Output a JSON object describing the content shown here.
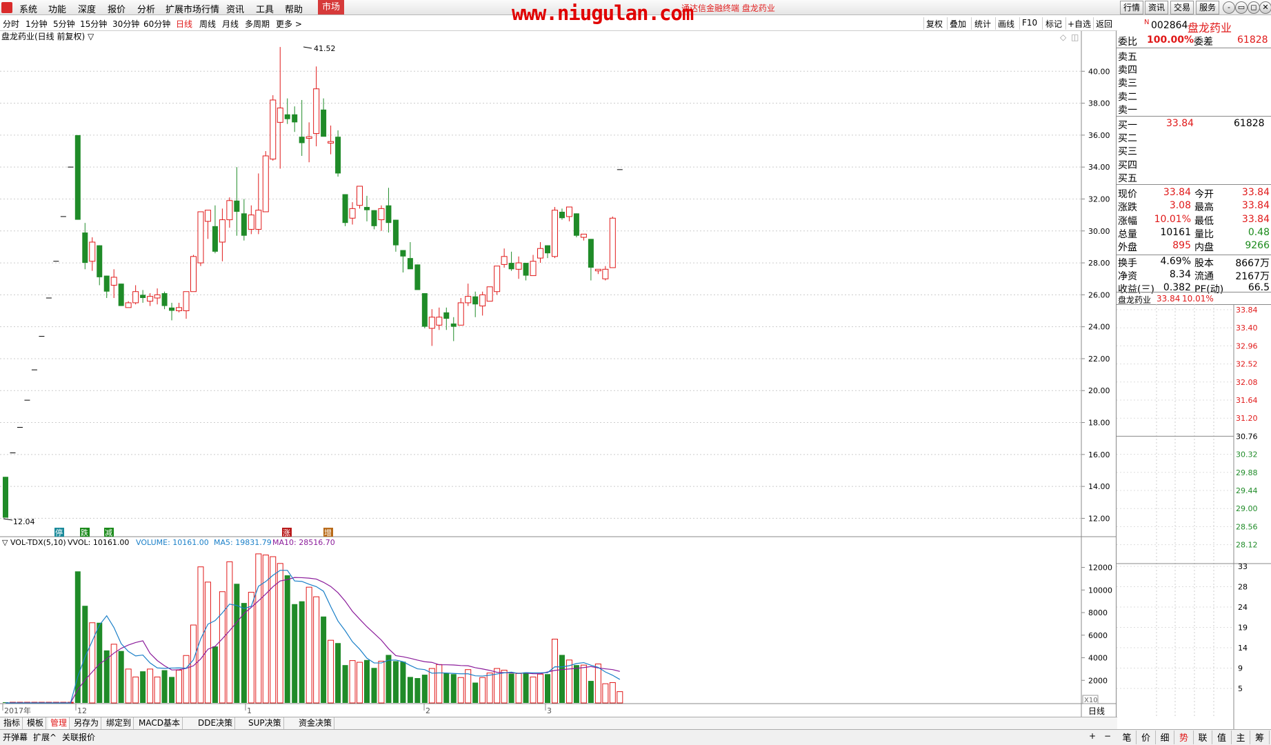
{
  "menu": [
    "系统",
    "功能",
    "深度",
    "报价",
    "分析",
    "扩展市场行情",
    "资讯",
    "工具",
    "帮助"
  ],
  "market_tab": "市场",
  "subtitle": "通达信金融终端 盘龙药业",
  "watermark": "www.niugulan.com",
  "top_buttons": [
    "行情",
    "资讯",
    "交易",
    "服务"
  ],
  "window_controls": [
    "-",
    "▭",
    "◻",
    "✕"
  ],
  "periods": [
    "分时",
    "1分钟",
    "5分钟",
    "15分钟",
    "30分钟",
    "60分钟",
    "日线",
    "周线",
    "月线",
    "多周期",
    "更多 >"
  ],
  "active_period": "日线",
  "toolbar_right": [
    "复权",
    "叠加",
    "统计",
    "画线",
    "F10",
    "标记",
    "+自选",
    "返回"
  ],
  "chart_title": "盘龙药业(日线 前复权) ▽",
  "price_axis": [
    "40.00",
    "38.00",
    "36.00",
    "34.00",
    "32.00",
    "30.00",
    "28.00",
    "26.00",
    "24.00",
    "22.00",
    "20.00",
    "18.00",
    "16.00",
    "14.00",
    "12.00"
  ],
  "high_label": "41.52",
  "low_label": "12.04",
  "signals": [
    {
      "t": "停",
      "color": "#1a8a9a"
    },
    {
      "t": "跌",
      "color": "#1a8a1a"
    },
    {
      "t": "减",
      "color": "#1a8a1a"
    },
    {
      "t": "涨",
      "color": "#b81818"
    },
    {
      "t": "增",
      "color": "#b86a18"
    }
  ],
  "vol_header": {
    "name": "▽ VOL-TDX(5,10)",
    "vvol": "VVOL: 10161.00",
    "volume": "VOLUME: 10161.00",
    "ma5": "MA5: 19831.79",
    "ma10": "MA10: 28516.70"
  },
  "vol_axis": [
    "12000",
    "10000",
    "8000",
    "6000",
    "4000",
    "2000"
  ],
  "vol_unit": "X10",
  "date_labels": [
    "2017年",
    "12",
    "1",
    "2",
    "3"
  ],
  "period_right": "日线",
  "chart_data": {
    "type": "candlestick",
    "title": "盘龙药业(日线 前复权)",
    "ylim": [
      11.5,
      42.0
    ],
    "candles": [
      [
        14.6,
        12.04,
        14.6,
        12.04
      ],
      [
        16.1,
        16.1,
        16.1,
        16.1
      ],
      [
        17.7,
        17.7,
        17.7,
        17.7
      ],
      [
        19.4,
        19.4,
        19.4,
        19.4
      ],
      [
        21.3,
        21.3,
        21.3,
        21.3
      ],
      [
        23.4,
        23.4,
        23.4,
        23.4
      ],
      [
        25.8,
        25.8,
        25.8,
        25.8
      ],
      [
        28.1,
        28.1,
        28.1,
        28.1
      ],
      [
        30.9,
        30.9,
        30.9,
        30.9
      ],
      [
        34.0,
        34.0,
        34.0,
        34.0
      ],
      [
        36.0,
        36.0,
        30.7,
        30.7
      ],
      [
        29.9,
        30.5,
        27.6,
        28.0
      ],
      [
        28.1,
        29.6,
        27.5,
        29.3
      ],
      [
        29.1,
        29.1,
        26.6,
        27.1
      ],
      [
        27.2,
        27.2,
        25.8,
        26.2
      ],
      [
        26.6,
        27.6,
        25.8,
        27.1
      ],
      [
        26.7,
        26.7,
        25.3,
        25.3
      ],
      [
        25.2,
        25.6,
        25.2,
        25.5
      ],
      [
        25.5,
        26.6,
        25.4,
        26.2
      ],
      [
        26.0,
        26.3,
        25.5,
        25.8
      ],
      [
        25.6,
        26.1,
        25.3,
        25.9
      ],
      [
        25.8,
        26.4,
        25.4,
        26.0
      ],
      [
        26.1,
        26.2,
        25.1,
        25.3
      ],
      [
        25.2,
        25.5,
        24.4,
        25.0
      ],
      [
        25.0,
        25.5,
        24.9,
        25.2
      ],
      [
        25.0,
        26.1,
        24.5,
        26.2
      ],
      [
        26.2,
        28.5,
        26.2,
        28.4
      ],
      [
        28.0,
        31.2,
        27.8,
        31.2
      ],
      [
        30.6,
        31.3,
        29.5,
        31.3
      ],
      [
        30.3,
        31.6,
        28.6,
        28.7
      ],
      [
        29.3,
        31.4,
        28.1,
        30.7
      ],
      [
        30.7,
        32.1,
        30.2,
        31.9
      ],
      [
        31.9,
        34.0,
        29.7,
        31.2
      ],
      [
        31.1,
        32.0,
        29.4,
        29.7
      ],
      [
        30.1,
        31.6,
        29.8,
        31.0
      ],
      [
        30.1,
        33.6,
        29.8,
        31.3
      ],
      [
        31.2,
        35.0,
        31.2,
        34.7
      ],
      [
        34.5,
        38.5,
        34.4,
        38.2
      ],
      [
        36.8,
        41.52,
        33.9,
        37.7
      ],
      [
        37.3,
        38.3,
        36.7,
        37.0
      ],
      [
        37.3,
        37.8,
        36.2,
        36.8
      ],
      [
        35.9,
        38.2,
        34.7,
        35.5
      ],
      [
        35.8,
        36.8,
        34.3,
        35.9
      ],
      [
        36.1,
        40.3,
        35.3,
        38.9
      ],
      [
        37.6,
        38.3,
        36.1,
        35.9
      ],
      [
        35.5,
        36.6,
        34.8,
        35.6
      ],
      [
        35.9,
        36.3,
        33.4,
        33.6
      ],
      [
        32.3,
        32.3,
        30.3,
        30.5
      ],
      [
        30.8,
        31.8,
        30.4,
        31.4
      ],
      [
        31.6,
        32.3,
        31.4,
        32.8
      ],
      [
        31.5,
        32.2,
        30.6,
        31.3
      ],
      [
        31.3,
        31.3,
        30.1,
        30.3
      ],
      [
        30.7,
        31.6,
        30.0,
        31.4
      ],
      [
        31.6,
        32.7,
        29.9,
        30.5
      ],
      [
        30.7,
        30.7,
        28.7,
        29.1
      ],
      [
        28.8,
        28.8,
        27.4,
        28.4
      ],
      [
        28.3,
        29.3,
        27.8,
        27.6
      ],
      [
        27.9,
        27.9,
        26.5,
        26.3
      ],
      [
        26.1,
        26.1,
        23.9,
        24.0
      ],
      [
        23.9,
        25.1,
        22.8,
        24.6
      ],
      [
        24.1,
        25.2,
        23.8,
        24.6
      ],
      [
        24.9,
        25.2,
        23.8,
        24.5
      ],
      [
        24.2,
        24.6,
        23.1,
        24.0
      ],
      [
        24.1,
        25.8,
        24.1,
        25.5
      ],
      [
        25.5,
        26.7,
        25.3,
        25.9
      ],
      [
        25.9,
        26.2,
        24.6,
        25.4
      ],
      [
        25.3,
        26.2,
        24.7,
        26.0
      ],
      [
        25.6,
        26.3,
        25.6,
        26.5
      ],
      [
        26.2,
        27.8,
        26.0,
        27.8
      ],
      [
        27.9,
        28.9,
        27.7,
        28.4
      ],
      [
        28.0,
        28.7,
        27.5,
        27.6
      ],
      [
        27.6,
        28.4,
        27.0,
        28.0
      ],
      [
        28.0,
        28.0,
        26.9,
        27.2
      ],
      [
        27.2,
        28.5,
        27.2,
        28.1
      ],
      [
        28.3,
        29.3,
        28.0,
        28.9
      ],
      [
        29.1,
        29.1,
        28.3,
        28.6
      ],
      [
        28.4,
        31.5,
        28.3,
        31.3
      ],
      [
        31.2,
        31.4,
        30.7,
        30.8
      ],
      [
        30.9,
        31.5,
        30.6,
        31.5
      ],
      [
        31.1,
        31.1,
        29.6,
        29.7
      ],
      [
        29.6,
        29.6,
        29.4,
        29.8
      ],
      [
        29.5,
        29.5,
        26.9,
        27.7
      ],
      [
        27.5,
        27.5,
        27.3,
        27.6
      ],
      [
        27.0,
        27.8,
        26.9,
        27.6
      ],
      [
        27.7,
        30.9,
        27.7,
        30.8
      ],
      [
        33.84,
        33.84,
        33.84,
        33.84
      ]
    ],
    "volume": [
      1,
      2,
      2,
      2,
      3,
      3,
      4,
      4,
      6,
      30,
      11650,
      8600,
      7100,
      7100,
      4650,
      5200,
      4600,
      3000,
      2300,
      2800,
      3000,
      2300,
      2900,
      2300,
      2900,
      4200,
      6900,
      12050,
      10700,
      5000,
      9850,
      12500,
      10550,
      8850,
      9800,
      13200,
      13100,
      12950,
      12350,
      11300,
      8750,
      9000,
      10250,
      9400,
      7650,
      5550,
      5300,
      3350,
      3750,
      3600,
      3800,
      3100,
      3700,
      4250,
      3700,
      3650,
      2300,
      2200,
      2500,
      3050,
      3400,
      2650,
      2550,
      2250,
      2950,
      1800,
      2250,
      2650,
      3050,
      2900,
      2600,
      2600,
      2700,
      2300,
      2550,
      2550,
      5650,
      4250,
      3800,
      3350,
      3350,
      1950,
      3450,
      1700,
      1800,
      1000
    ],
    "ma5": [
      0,
      0,
      0,
      0,
      0,
      0,
      0,
      0,
      0,
      0,
      2330,
      4060,
      5480,
      6900,
      7720,
      6680,
      5250,
      4560,
      4160,
      4240,
      3540,
      3100,
      3060,
      3090,
      3100,
      3080,
      3820,
      5660,
      6970,
      7290,
      7970,
      8750,
      8630,
      8360,
      8560,
      10330,
      10750,
      11300,
      11740,
      11740,
      10800,
      10760,
      10510,
      10300,
      9890,
      8530,
      7250,
      6390,
      5420,
      4760,
      3960,
      3540,
      3540,
      3780,
      3800,
      3650,
      3320,
      3020,
      2950,
      2630,
      2660,
      2650,
      2610,
      2580,
      2580,
      2400,
      2380,
      2460,
      2560,
      2660,
      2730,
      2600,
      2680,
      2660,
      2670,
      2680,
      3200,
      3190,
      3300,
      3490,
      3570,
      3340,
      3150,
      2740,
      2450,
      2080
    ],
    "ma10": [
      0,
      0,
      0,
      0,
      0,
      0,
      0,
      0,
      0,
      0,
      1170,
      2030,
      2740,
      3450,
      3890,
      4410,
      4830,
      5130,
      5350,
      5500,
      4390,
      3750,
      3290,
      2920,
      2940,
      3060,
      3290,
      3890,
      4750,
      5010,
      5680,
      6390,
      7150,
      7920,
      8460,
      9040,
      9640,
      10290,
      10800,
      10920,
      11110,
      11090,
      11050,
      10970,
      10680,
      10310,
      9760,
      9010,
      8110,
      7420,
      6750,
      6160,
      5560,
      4800,
      4190,
      4090,
      3950,
      3790,
      3650,
      3590,
      3380,
      3380,
      3360,
      3310,
      3290,
      3120,
      3010,
      2880,
      2710,
      2680,
      2660,
      2630,
      2640,
      2590,
      2580,
      2740,
      2880,
      2950,
      3010,
      3060,
      3130,
      3220,
      3100,
      3020,
      2950,
      2790
    ],
    "vol_ylim": [
      0,
      13500
    ]
  },
  "quote": {
    "code": "002864",
    "name": "盘龙药业",
    "n_mark": "N",
    "weibi_label": "委比",
    "weibi": "100.00%",
    "weicha_label": "委差",
    "weicha": "61828",
    "sells": [
      "卖五",
      "卖四",
      "卖三",
      "卖二",
      "卖一"
    ],
    "buys": [
      {
        "l": "买一",
        "p": "33.84",
        "v": "61828"
      },
      {
        "l": "买二",
        "p": "",
        "v": ""
      },
      {
        "l": "买三",
        "p": "",
        "v": ""
      },
      {
        "l": "买四",
        "p": "",
        "v": ""
      },
      {
        "l": "买五",
        "p": "",
        "v": ""
      }
    ],
    "stats": [
      {
        "l1": "现价",
        "v1": "33.84",
        "l2": "今开",
        "v2": "33.84",
        "c1": "red",
        "c2": "red"
      },
      {
        "l1": "涨跌",
        "v1": "3.08",
        "l2": "最高",
        "v2": "33.84",
        "c1": "red",
        "c2": "red"
      },
      {
        "l1": "涨幅",
        "v1": "10.01%",
        "l2": "最低",
        "v2": "33.84",
        "c1": "red",
        "c2": "red"
      },
      {
        "l1": "总量",
        "v1": "10161",
        "l2": "量比",
        "v2": "0.48",
        "c1": "blk",
        "c2": "grn"
      },
      {
        "l1": "外盘",
        "v1": "895",
        "l2": "内盘",
        "v2": "9266",
        "c1": "red",
        "c2": "grn"
      },
      {
        "l1": "换手",
        "v1": "4.69%",
        "l2": "股本",
        "v2": "8667万",
        "c1": "blk",
        "c2": "blk"
      },
      {
        "l1": "净资",
        "v1": "8.34",
        "l2": "流通",
        "v2": "2167万",
        "c1": "blk",
        "c2": "blk"
      },
      {
        "l1": "收益(三)",
        "v1": "0.382",
        "l2": "PE(动)",
        "v2": "66.5",
        "c1": "blk",
        "c2": "blk"
      }
    ],
    "mini_title": "盘龙药业",
    "mini_price": "33.84",
    "mini_pct": "10.01%",
    "mini_axis": [
      "33.84",
      "33.40",
      "32.96",
      "32.52",
      "32.08",
      "31.64",
      "31.20",
      "30.76",
      "30.32",
      "29.88",
      "29.44",
      "29.00",
      "28.56",
      "28.12"
    ],
    "mini_vol_axis": [
      "33",
      "28",
      "24",
      "19",
      "14",
      "9",
      "5"
    ]
  },
  "bottom_tabs": [
    "指标",
    "模板",
    "管理",
    "另存为",
    "绑定到",
    "MACD基本",
    "DDE决策",
    "SUP决策",
    "资金决策"
  ],
  "active_bottom_tab": "管理",
  "status_left": [
    "开弹幕",
    "扩展^",
    "关联报价"
  ],
  "right_tabs": [
    "笔",
    "价",
    "细",
    "势",
    "联",
    "值",
    "主",
    "筹"
  ],
  "active_right_tab": "势"
}
